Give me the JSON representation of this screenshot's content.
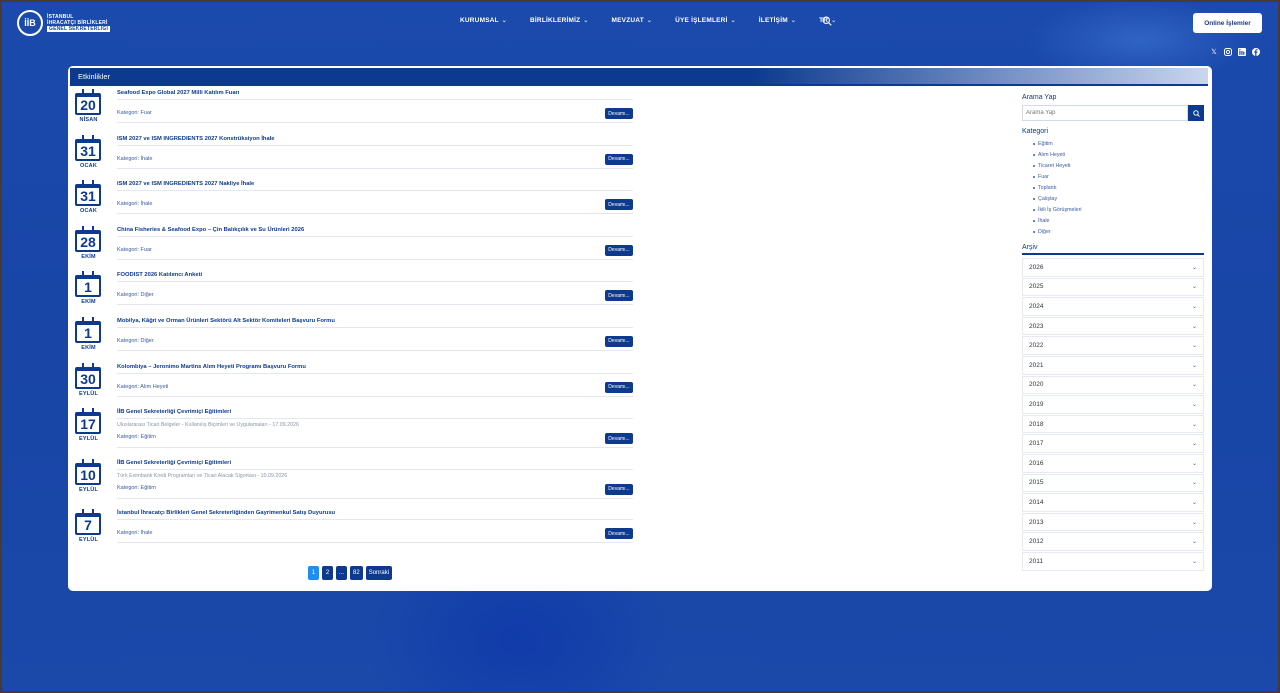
{
  "header": {
    "logo_mark": "İİB",
    "logo_lines": [
      "İSTANBUL",
      "İHRACATÇI BİRLİKLERİ",
      "GENEL SEKRETERLİĞİ"
    ],
    "nav": [
      "KURUMSAL",
      "BİRLİKLERİMİZ",
      "MEVZUAT",
      "ÜYE İŞLEMLERİ",
      "İLETİŞİM",
      "TR"
    ],
    "online_button": "Online İşlemler",
    "social_icons": [
      "x-icon",
      "instagram-icon",
      "linkedin-icon",
      "facebook-icon"
    ]
  },
  "page": {
    "title": "Etkinlikler"
  },
  "events": [
    {
      "day": "20",
      "month": "NİSAN",
      "title": "Seafood Expo Global 2027 Milli Katılım Fuarı",
      "subtitle": "",
      "category": "Kategori: Fuar",
      "button": "Devamı..."
    },
    {
      "day": "31",
      "month": "OCAK",
      "title": "ISM 2027 ve ISM INGREDIENTS 2027 Konstrüksiyon İhale",
      "subtitle": "",
      "category": "Kategori: İhale",
      "button": "Devamı..."
    },
    {
      "day": "31",
      "month": "OCAK",
      "title": "ISM 2027 ve ISM INGREDIENTS 2027 Nakliye İhale",
      "subtitle": "",
      "category": "Kategori: İhale",
      "button": "Devamı..."
    },
    {
      "day": "28",
      "month": "EKİM",
      "title": "China Fisheries & Seafood Expo – Çin Balıkçılık ve Su Ürünleri 2026",
      "subtitle": "",
      "category": "Kategori: Fuar",
      "button": "Devamı..."
    },
    {
      "day": "1",
      "month": "EKİM",
      "title": "FOODIST 2026 Katılımcı Anketi",
      "subtitle": "",
      "category": "Kategori: Diğer",
      "button": "Devamı..."
    },
    {
      "day": "1",
      "month": "EKİM",
      "title": "Mobilya, Kâğıt ve Orman Ürünleri Sektörü Alt Sektör Komiteleri Başvuru Formu",
      "subtitle": "",
      "category": "Kategori: Diğer",
      "button": "Devamı..."
    },
    {
      "day": "30",
      "month": "EYLÜL",
      "title": "Kolombiya – Jeronimo Martins Alım Heyeti Programı Başvuru Formu",
      "subtitle": "",
      "category": "Kategori: Alım Heyeti",
      "button": "Devamı..."
    },
    {
      "day": "17",
      "month": "EYLÜL",
      "title": "İİB Genel Sekreterliği Çevrimiçi Eğitimleri",
      "subtitle": "Uluslararası Ticari Belgeler - Kullanılış Biçimleri ve Uygulamaları - 17.09.2026",
      "category": "Kategori: Eğitim",
      "button": "Devamı..."
    },
    {
      "day": "10",
      "month": "EYLÜL",
      "title": "İİB Genel Sekreterliği Çevrimiçi Eğitimleri",
      "subtitle": "Türk Eximbank Kredi Programları ve Ticari Alacak Sigortası - 10.09.2026",
      "category": "Kategori: Eğitim",
      "button": "Devamı..."
    },
    {
      "day": "7",
      "month": "EYLÜL",
      "title": "İstanbul İhracatçı Birlikleri Genel Sekreterliğinden Gayrimenkul Satış Duyurusu",
      "subtitle": "",
      "category": "Kategori: İhale",
      "button": "Devamı..."
    }
  ],
  "pagination": [
    "1",
    "2",
    "...",
    "82",
    "Sonraki"
  ],
  "sidebar": {
    "search_heading": "Arama Yap",
    "search_placeholder": "Arama Yap",
    "category_heading": "Kategori",
    "categories": [
      "Eğitim",
      "Alım Heyeti",
      "Ticaret Heyeti",
      "Fuar",
      "Toplantı",
      "Çalıştay",
      "İkili İş Görüşmeleri",
      "İhale",
      "Diğer"
    ],
    "archive_heading": "Arşiv",
    "years": [
      "2026",
      "2025",
      "2024",
      "2023",
      "2022",
      "2021",
      "2020",
      "2019",
      "2018",
      "2017",
      "2016",
      "2015",
      "2014",
      "2013",
      "2012",
      "2011"
    ]
  }
}
